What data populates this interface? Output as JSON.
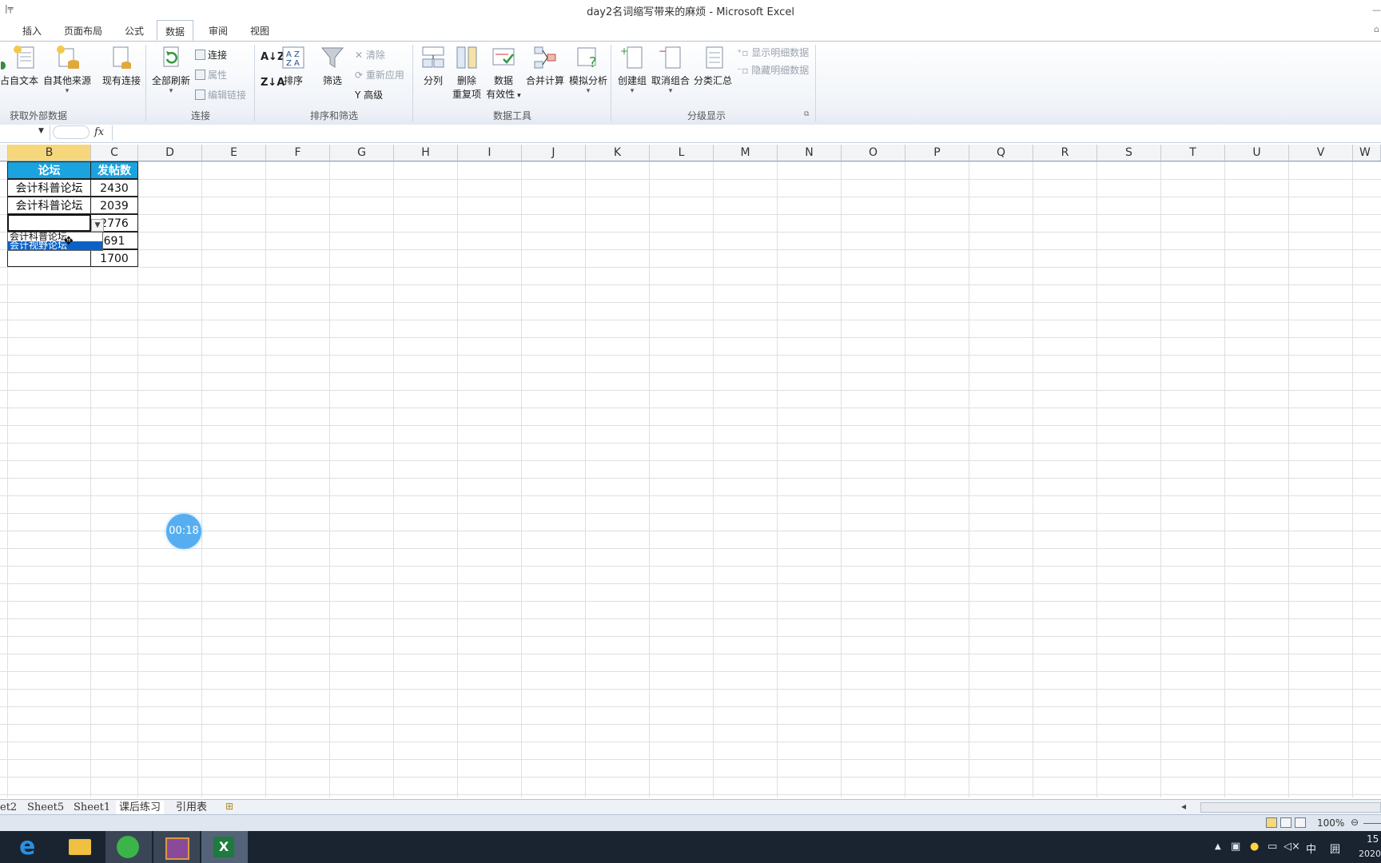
{
  "window": {
    "title": "day2名词缩写带来的麻烦 - Microsoft Excel",
    "qat": "|╤"
  },
  "tabs": [
    {
      "label": "插入",
      "active": false
    },
    {
      "label": "页面布局",
      "active": false
    },
    {
      "label": "公式",
      "active": false
    },
    {
      "label": "数据",
      "active": true
    },
    {
      "label": "审阅",
      "active": false
    },
    {
      "label": "视图",
      "active": false
    }
  ],
  "ribbon": {
    "get_external": {
      "partial": "占",
      "from_text": "自文本",
      "other_sources": "自其他来源",
      "existing": "现有连接",
      "label": "获取外部数据"
    },
    "connections": {
      "refresh_all": "全部刷新",
      "connections": "连接",
      "properties": "属性",
      "edit_links": "编辑链接",
      "label": "连接"
    },
    "sort_filter": {
      "sort": "排序",
      "filter": "筛选",
      "clear": "清除",
      "reapply": "重新应用",
      "advanced": "高级",
      "label": "排序和筛选"
    },
    "data_tools": {
      "text_to_columns": "分列",
      "remove_dup_1": "删除",
      "remove_dup_2": "重复项",
      "validation_1": "数据",
      "validation_2": "有效性",
      "consolidate": "合并计算",
      "what_if": "模拟分析",
      "label": "数据工具"
    },
    "outline": {
      "group": "创建组",
      "ungroup": "取消组合",
      "subtotal": "分类汇总",
      "show_detail": "显示明细数据",
      "hide_detail": "隐藏明细数据",
      "label": "分级显示"
    }
  },
  "formula_bar": {
    "fx": "fx",
    "value": ""
  },
  "columns": [
    "B",
    "C",
    "D",
    "E",
    "F",
    "G",
    "H",
    "I",
    "J",
    "K",
    "L",
    "M",
    "N",
    "O",
    "P",
    "Q",
    "R",
    "S",
    "T",
    "U",
    "V",
    "W"
  ],
  "table": {
    "headers": [
      "论坛",
      "发帖数"
    ],
    "rows": [
      [
        "会计科普论坛",
        "2430"
      ],
      [
        "会计科普论坛",
        "2039"
      ],
      [
        "",
        "2776"
      ],
      [
        "",
        "691"
      ],
      [
        "",
        "1700"
      ]
    ]
  },
  "dropdown": {
    "options": [
      "会计科普论坛",
      "会计视野论坛"
    ],
    "highlighted": 1
  },
  "timer": "00:18",
  "sheet_tabs": [
    {
      "label": "et2",
      "active": false
    },
    {
      "label": "Sheet5",
      "active": false
    },
    {
      "label": "Sheet1",
      "active": false
    },
    {
      "label": "课后练习",
      "active": true
    },
    {
      "label": "引用表",
      "active": false
    }
  ],
  "status": {
    "zoom": "100%"
  },
  "taskbar": {
    "tray_ime": "中",
    "tray_sym": "囲",
    "clock_time": "15",
    "clock_date": "2020"
  },
  "colors": {
    "header_fill": "#1aa3df",
    "selected_col": "#f7d77c",
    "highlight": "#0a62c8"
  }
}
